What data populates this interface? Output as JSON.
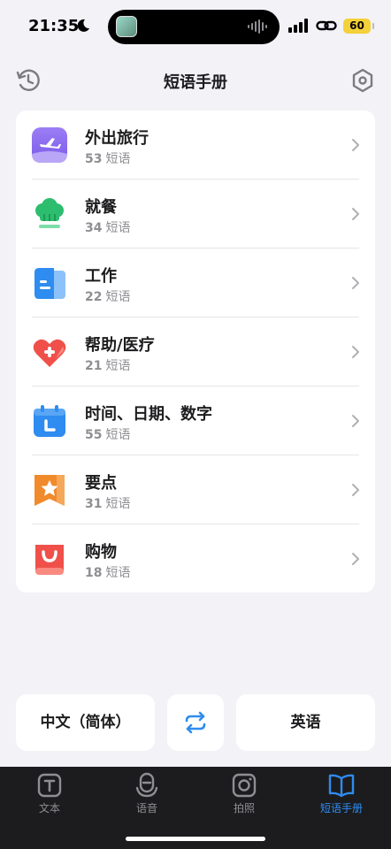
{
  "status_bar": {
    "time": "21:35",
    "battery": "60"
  },
  "header": {
    "title": "短语手册",
    "left_icon": "history-icon",
    "right_icon": "settings-hexagon-icon"
  },
  "categories": [
    {
      "name": "外出旅行",
      "count": "53",
      "unit": "短语",
      "icon": "airplane-icon",
      "color": "#8b6cf0"
    },
    {
      "name": "就餐",
      "count": "34",
      "unit": "短语",
      "icon": "chef-hat-icon",
      "color": "#2dbd6e"
    },
    {
      "name": "工作",
      "count": "22",
      "unit": "短语",
      "icon": "document-icon",
      "color": "#2f8cf0"
    },
    {
      "name": "帮助/医疗",
      "count": "21",
      "unit": "短语",
      "icon": "heart-plus-icon",
      "color": "#f0504a"
    },
    {
      "name": "时间、日期、数字",
      "count": "55",
      "unit": "短语",
      "icon": "calendar-icon",
      "color": "#2f8cf0"
    },
    {
      "name": "要点",
      "count": "31",
      "unit": "短语",
      "icon": "star-bookmark-icon",
      "color": "#f08a2a"
    },
    {
      "name": "购物",
      "count": "18",
      "unit": "短语",
      "icon": "shopping-bag-icon",
      "color": "#f0504a"
    }
  ],
  "language": {
    "source": "中文（简体）",
    "target": "英语",
    "swap_icon": "swap-arrows-icon"
  },
  "tabs": [
    {
      "label": "文本",
      "icon": "text-icon",
      "active": false
    },
    {
      "label": "语音",
      "icon": "microphone-icon",
      "active": false
    },
    {
      "label": "拍照",
      "icon": "camera-icon",
      "active": false
    },
    {
      "label": "短语手册",
      "icon": "book-icon",
      "active": true
    }
  ],
  "colors": {
    "accent": "#2f8cf0",
    "background": "#f2f2f7",
    "tab_bar": "#1c1c1e",
    "battery": "#f4d03a"
  }
}
